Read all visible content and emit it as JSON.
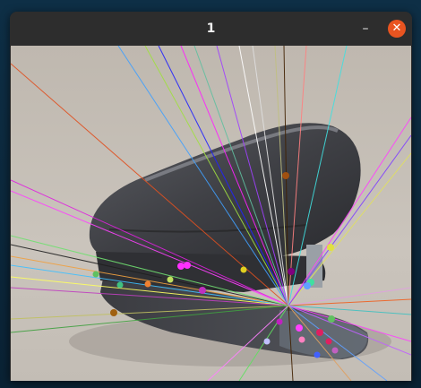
{
  "window": {
    "title": "1",
    "minimize_glyph": "–",
    "close_glyph": "✕"
  },
  "colors": {
    "titlebar": "#2d2d2d",
    "close_button": "#e95420",
    "desktop": "#0b2a3f"
  },
  "image": {
    "subject_icon": "stapler-photo-with-feature-lines"
  }
}
